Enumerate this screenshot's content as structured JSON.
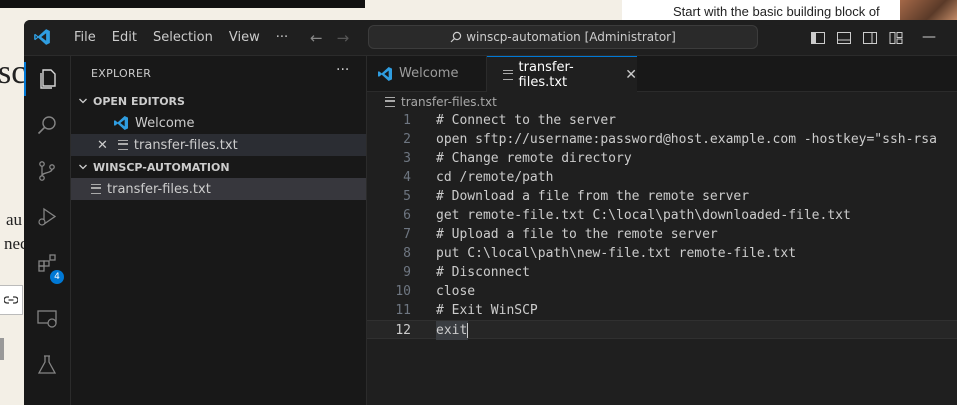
{
  "background": {
    "right_text": "Start with the basic building block of",
    "left_fragments": [
      "sc",
      "au",
      "nec"
    ]
  },
  "window": {
    "menu": [
      "File",
      "Edit",
      "Selection",
      "View",
      "···"
    ],
    "command_center": "winscp-automation [Administrator]",
    "minimize_glyph": "—"
  },
  "activity_bar": {
    "items": [
      "explorer-icon",
      "search-icon",
      "source-control-icon",
      "run-debug-icon",
      "extensions-icon",
      "remote-explorer-icon",
      "testing-icon"
    ],
    "extensions_badge": "4"
  },
  "sidebar": {
    "title": "EXPLORER",
    "more": "···",
    "open_editors_header": "OPEN EDITORS",
    "open_editors": [
      {
        "label": "Welcome"
      },
      {
        "label": "transfer-files.txt",
        "close": "✕"
      }
    ],
    "workspace_header": "WINSCP-AUTOMATION",
    "files": [
      "transfer-files.txt"
    ]
  },
  "editor": {
    "tabs": [
      {
        "label": "Welcome"
      },
      {
        "label": "transfer-files.txt",
        "close": "✕"
      }
    ],
    "breadcrumb": "transfer-files.txt",
    "lines": [
      {
        "n": "1",
        "text": "# Connect to the server"
      },
      {
        "n": "2",
        "text": "open sftp://username:password@host.example.com -hostkey=\"ssh-rsa"
      },
      {
        "n": "3",
        "text": "# Change remote directory"
      },
      {
        "n": "4",
        "text": "cd /remote/path"
      },
      {
        "n": "5",
        "text": "# Download a file from the remote server"
      },
      {
        "n": "6",
        "text": "get remote-file.txt C:\\local\\path\\downloaded-file.txt"
      },
      {
        "n": "7",
        "text": "# Upload a file to the remote server"
      },
      {
        "n": "8",
        "text": "put C:\\local\\path\\new-file.txt remote-file.txt"
      },
      {
        "n": "9",
        "text": "# Disconnect"
      },
      {
        "n": "10",
        "text": "close"
      },
      {
        "n": "11",
        "text": "# Exit WinSCP"
      },
      {
        "n": "12",
        "text": "exit"
      }
    ]
  },
  "colors": {
    "accent": "#0078d4",
    "logo": "#2f9de0",
    "editor_bg": "#1f1f1f",
    "sidebar_bg": "#181818"
  }
}
